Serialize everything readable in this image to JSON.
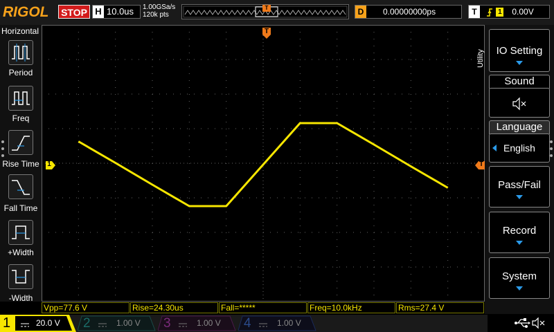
{
  "topbar": {
    "logo": "RIGOL",
    "run_state": "STOP",
    "timebase_label": "H",
    "timebase": "10.0us",
    "sample_rate": "1.00GSa/s",
    "memory_depth": "120k pts",
    "trigger_pos_marker": "T",
    "delay_label": "D",
    "delay": "0.00000000ps",
    "trigger_label": "T",
    "trigger_source": "1",
    "trigger_level": "0.00V"
  },
  "left_panel": {
    "title": "Horizontal",
    "items": [
      {
        "label": "Period",
        "icon": "period-icon"
      },
      {
        "label": "Freq",
        "icon": "freq-icon"
      },
      {
        "label": "Rise Time",
        "icon": "rise-time-icon"
      },
      {
        "label": "Fall Time",
        "icon": "fall-time-icon"
      },
      {
        "label": "+Width",
        "icon": "positive-width-icon"
      },
      {
        "label": "-Width",
        "icon": "negative-width-icon"
      }
    ]
  },
  "right_panel": {
    "tab": "Utility",
    "io_setting": "IO Setting",
    "sound_title": "Sound",
    "sound_icon": "speaker-muted-icon",
    "language_title": "Language",
    "language_value": "English",
    "pass_fail": "Pass/Fail",
    "record": "Record",
    "system": "System"
  },
  "markers": {
    "trigger_top": "T",
    "channel_marker": "1",
    "trigger_level_marker": "T"
  },
  "measurements": [
    {
      "text": "Vpp=77.6 V"
    },
    {
      "text": "Rise=24.30us"
    },
    {
      "text": "Fall=*****"
    },
    {
      "text": "Freq=10.0kHz"
    },
    {
      "text": "Rms=27.4 V"
    }
  ],
  "channels": [
    {
      "num": "1",
      "scale": "20.0 V",
      "color": "#f7e600"
    },
    {
      "num": "2",
      "scale": "1.00 V",
      "color": "#1fd0c4"
    },
    {
      "num": "3",
      "scale": "1.00 V",
      "color": "#d64fd6"
    },
    {
      "num": "4",
      "scale": "1.00 V",
      "color": "#2b7ce8"
    }
  ],
  "status_icons": [
    "usb-icon",
    "speaker-muted-icon"
  ],
  "waveform": {
    "color": "#f7e600",
    "volts_per_div": 20.0,
    "time_per_div_us": 10.0,
    "points": [
      [
        -50,
        13.4
      ],
      [
        -40,
        1.0
      ],
      [
        -30,
        -11.6
      ],
      [
        -20,
        -24.0
      ],
      [
        -10,
        -24.0
      ],
      [
        0,
        0.0
      ],
      [
        10,
        24.0
      ],
      [
        15,
        24.0
      ],
      [
        20,
        24.0
      ],
      [
        30,
        11.6
      ],
      [
        40,
        -1.0
      ],
      [
        50,
        -13.4
      ]
    ]
  }
}
